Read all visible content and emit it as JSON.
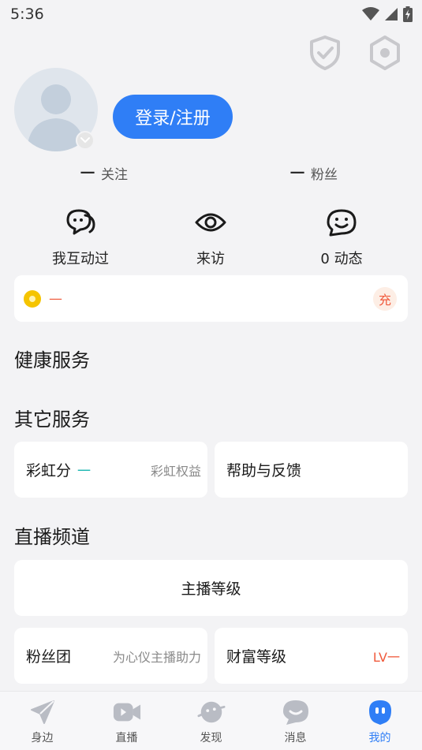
{
  "status_bar": {
    "time": "5:36"
  },
  "profile": {
    "login_label": "登录/注册"
  },
  "follow": {
    "following_count": "一",
    "following_label": "关注",
    "fans_count": "一",
    "fans_label": "粉丝"
  },
  "quick_actions": [
    {
      "label": "我互动过",
      "icon": "chat-bubbles-icon"
    },
    {
      "label": "来访",
      "icon": "eye-icon"
    },
    {
      "label": "0 动态",
      "icon": "smile-face-icon"
    }
  ],
  "coins": {
    "value": "—",
    "charge_label": "充"
  },
  "sections": {
    "health": "健康服务",
    "other": "其它服务",
    "live": "直播频道"
  },
  "services": {
    "rainbow_score_label": "彩虹分",
    "rainbow_score_value": "一",
    "rainbow_rights": "彩虹权益",
    "help_feedback": "帮助与反馈"
  },
  "live_channel": {
    "anchor_level": "主播等级",
    "fan_club": "粉丝团",
    "fan_club_sub": "为心仪主播助力",
    "wealth_level": "财富等级",
    "wealth_value": "LV一"
  },
  "tabs": [
    {
      "label": "身边",
      "icon": "paper-plane-icon",
      "active": false
    },
    {
      "label": "直播",
      "icon": "video-camera-icon",
      "active": false
    },
    {
      "label": "发现",
      "icon": "planet-icon",
      "active": false
    },
    {
      "label": "消息",
      "icon": "message-bubble-icon",
      "active": false
    },
    {
      "label": "我的",
      "icon": "profile-face-icon",
      "active": true
    }
  ],
  "colors": {
    "accent": "#2f7ef6",
    "coin": "#f5c400",
    "warn": "#f05a3c",
    "teal": "#19b5b0"
  }
}
